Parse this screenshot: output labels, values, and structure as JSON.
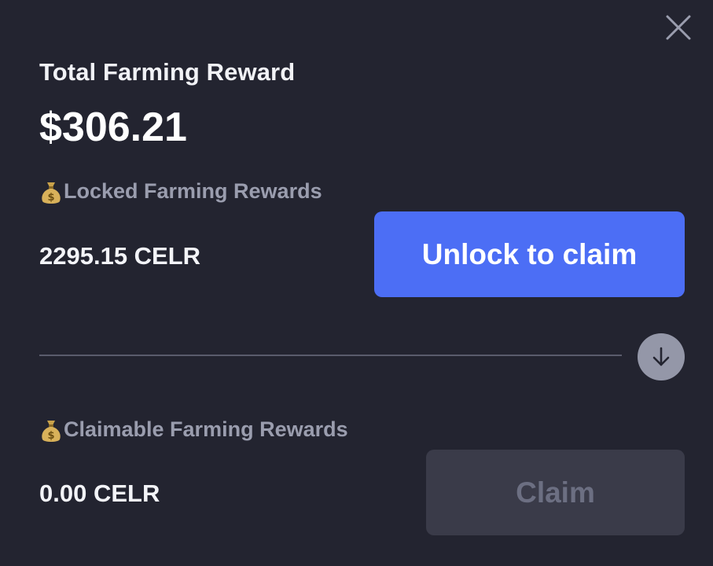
{
  "modal": {
    "close_icon": "close-icon",
    "title": "Total Farming Reward",
    "total_amount": "$306.21"
  },
  "locked": {
    "icon": "money-bag-icon",
    "label": "Locked Farming Rewards",
    "value": "2295.15 CELR",
    "button_label": "Unlock to claim"
  },
  "separator": {
    "icon": "arrow-down-icon"
  },
  "claimable": {
    "icon": "money-bag-icon",
    "label": "Claimable Farming Rewards",
    "value": "0.00 CELR",
    "button_label": "Claim",
    "button_disabled": true
  },
  "colors": {
    "background": "#232430",
    "accent": "#4c6ef5",
    "disabled_button": "#3a3b49",
    "muted_text": "#9a9dae"
  }
}
